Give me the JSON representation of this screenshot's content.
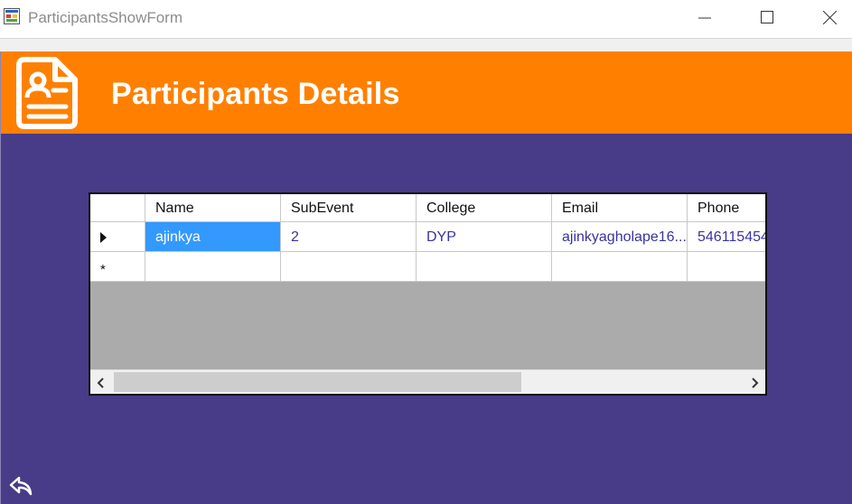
{
  "window": {
    "title": "ParticipantsShowForm",
    "icon": "winforms-app-icon"
  },
  "header": {
    "title": "Participants Details",
    "icon": "document-person-icon",
    "color": "#ff8000"
  },
  "background_color": "#483b88",
  "grid": {
    "columns": [
      "Name",
      "SubEvent",
      "College",
      "Email",
      "Phone"
    ],
    "rows": [
      [
        "ajinkya",
        "2",
        "DYP",
        "ajinkyagholape16...",
        "546115454"
      ]
    ],
    "selection_color": "#3399ff"
  },
  "footer": {
    "back_icon": "back-arrow-icon"
  }
}
